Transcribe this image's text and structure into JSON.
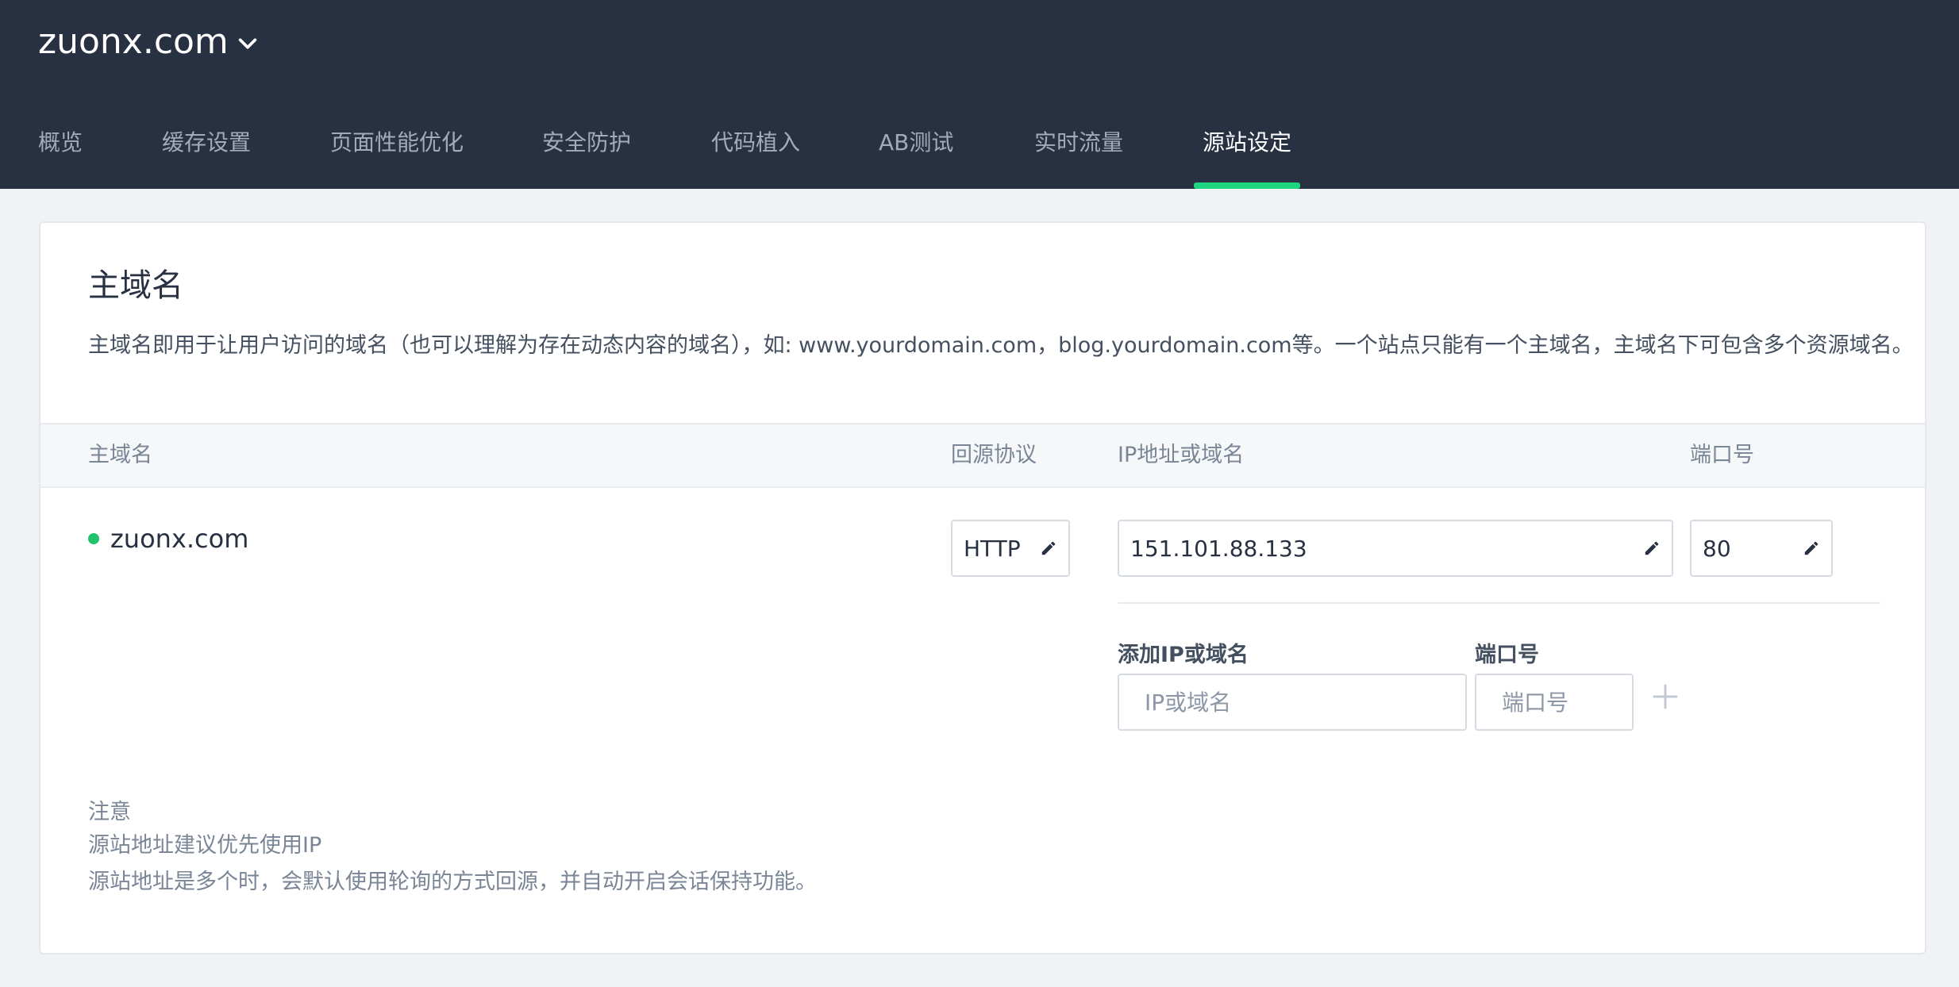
{
  "header": {
    "site_name": "zuonx.com",
    "tabs": [
      {
        "label": "概览"
      },
      {
        "label": "缓存设置"
      },
      {
        "label": "页面性能优化"
      },
      {
        "label": "安全防护"
      },
      {
        "label": "代码植入"
      },
      {
        "label": "AB测试"
      },
      {
        "label": "实时流量"
      },
      {
        "label": "源站设定",
        "active": true
      }
    ]
  },
  "section": {
    "title": "主域名",
    "description": "主域名即用于让用户访问的域名（也可以理解为存在动态内容的域名），如: www.yourdomain.com，blog.yourdomain.com等。一个站点只能有一个主域名，主域名下可包含多个资源域名。"
  },
  "table": {
    "headers": {
      "domain": "主域名",
      "protocol": "回源协议",
      "address": "IP地址或域名",
      "port": "端口号"
    },
    "row": {
      "domain": "zuonx.com",
      "status_color": "#1fc36a",
      "protocol": "HTTP",
      "address": "151.101.88.133",
      "port": "80"
    }
  },
  "add_origin": {
    "address_label": "添加IP或域名",
    "port_label": "端口号",
    "address_placeholder": "IP或域名",
    "port_placeholder": "端口号"
  },
  "notes": {
    "title": "注意",
    "lines": [
      "源站地址建议优先使用IP",
      "源站地址是多个时，会默认使用轮询的方式回源，并自动开启会话保持功能。"
    ]
  },
  "colors": {
    "header_bg": "#273142",
    "accent": "#1ed67f",
    "page_bg": "#f1f2f5"
  }
}
